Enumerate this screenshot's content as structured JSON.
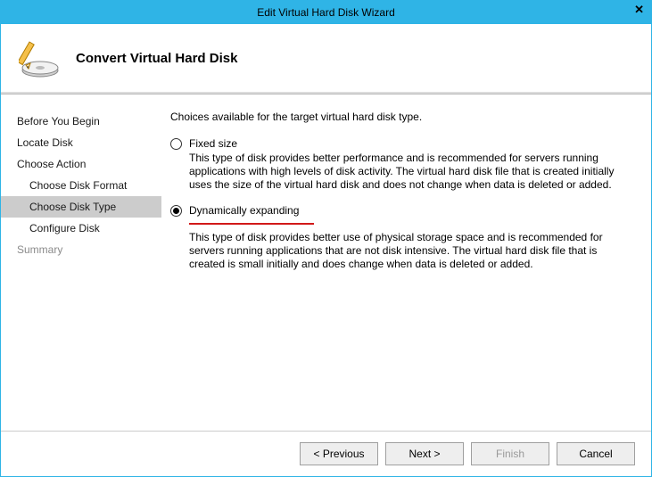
{
  "window": {
    "title": "Edit Virtual Hard Disk Wizard",
    "close_glyph": "✕"
  },
  "header": {
    "title": "Convert Virtual Hard Disk"
  },
  "sidebar": {
    "steps": [
      {
        "label": "Before You Begin",
        "sub": false,
        "selected": false,
        "disabled": false
      },
      {
        "label": "Locate Disk",
        "sub": false,
        "selected": false,
        "disabled": false
      },
      {
        "label": "Choose Action",
        "sub": false,
        "selected": false,
        "disabled": false
      },
      {
        "label": "Choose Disk Format",
        "sub": true,
        "selected": false,
        "disabled": false
      },
      {
        "label": "Choose Disk Type",
        "sub": true,
        "selected": true,
        "disabled": false
      },
      {
        "label": "Configure Disk",
        "sub": true,
        "selected": false,
        "disabled": false
      },
      {
        "label": "Summary",
        "sub": false,
        "selected": false,
        "disabled": true
      }
    ]
  },
  "content": {
    "intro": "Choices available for the target virtual hard disk type.",
    "options": {
      "fixed": {
        "label": "Fixed size",
        "checked": false,
        "desc": "This type of disk provides better performance and is recommended for servers running applications with high levels of disk activity. The virtual hard disk file that is created initially uses the size of the virtual hard disk and does not change when data is deleted or added."
      },
      "dynamic": {
        "label": "Dynamically expanding",
        "checked": true,
        "desc": "This type of disk provides better use of physical storage space and is recommended for servers running applications that are not disk intensive. The virtual hard disk file that is created is small initially and does change when data is deleted or added."
      }
    }
  },
  "footer": {
    "previous": "< Previous",
    "next": "Next >",
    "finish": "Finish",
    "cancel": "Cancel"
  }
}
